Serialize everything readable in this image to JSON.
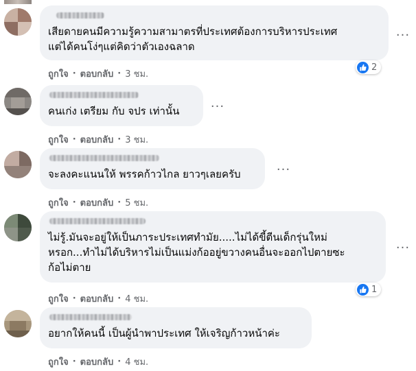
{
  "comments": [
    {
      "text": "เสียดายคนมีความรู้ความสามาตรที่ประเทศต้องการบริหารประเทศ\nแต่ได้คนโง่ๆแต่คิดว่าตัวเองฉลาด",
      "like_label": "ถูกใจ",
      "reply_label": "ตอบกลับ",
      "time": "3 ชม.",
      "reaction_count": "2"
    },
    {
      "text": "คนเก่ง เตรียม กับ จปร เท่านั้น",
      "like_label": "ถูกใจ",
      "reply_label": "ตอบกลับ",
      "time": "3 ชม."
    },
    {
      "text": "จะลงคะแนนให้ พรรคก้าวไกล ยาวๆเลยครับ",
      "like_label": "ถูกใจ",
      "reply_label": "ตอบกลับ",
      "time": "5 ชม."
    },
    {
      "text": "ไม่รู้.มันจะอยู่ให้เป็นภาระประเทศทำมัย.....ไม่ได้ขี้ตีนเด็กรุ่นใหม่\nหรอก...ทำไม่ได้บริหารไม่เป็นแม่งก้ออยู่ขวางคนอื่นจะออกไปตายซะ\nก้อไม่ตาย",
      "like_label": "ถูกใจ",
      "reply_label": "ตอบกลับ",
      "time": "4 ชม.",
      "reaction_count": "1"
    },
    {
      "text": "อยากให้คนนี้ เป็นผู้นำพาประเทศ ให้เจริญก้าวหน้าค่ะ",
      "like_label": "ถูกใจ",
      "reply_label": "ตอบกลับ",
      "time": "4 ชม."
    }
  ],
  "more_icon": "more-horizontal-icon",
  "reaction_icon": "thumbs-up-icon",
  "colors": {
    "bubble": "#f0f2f5",
    "secondary_text": "#65676b",
    "like_blue": "#1877f2"
  }
}
